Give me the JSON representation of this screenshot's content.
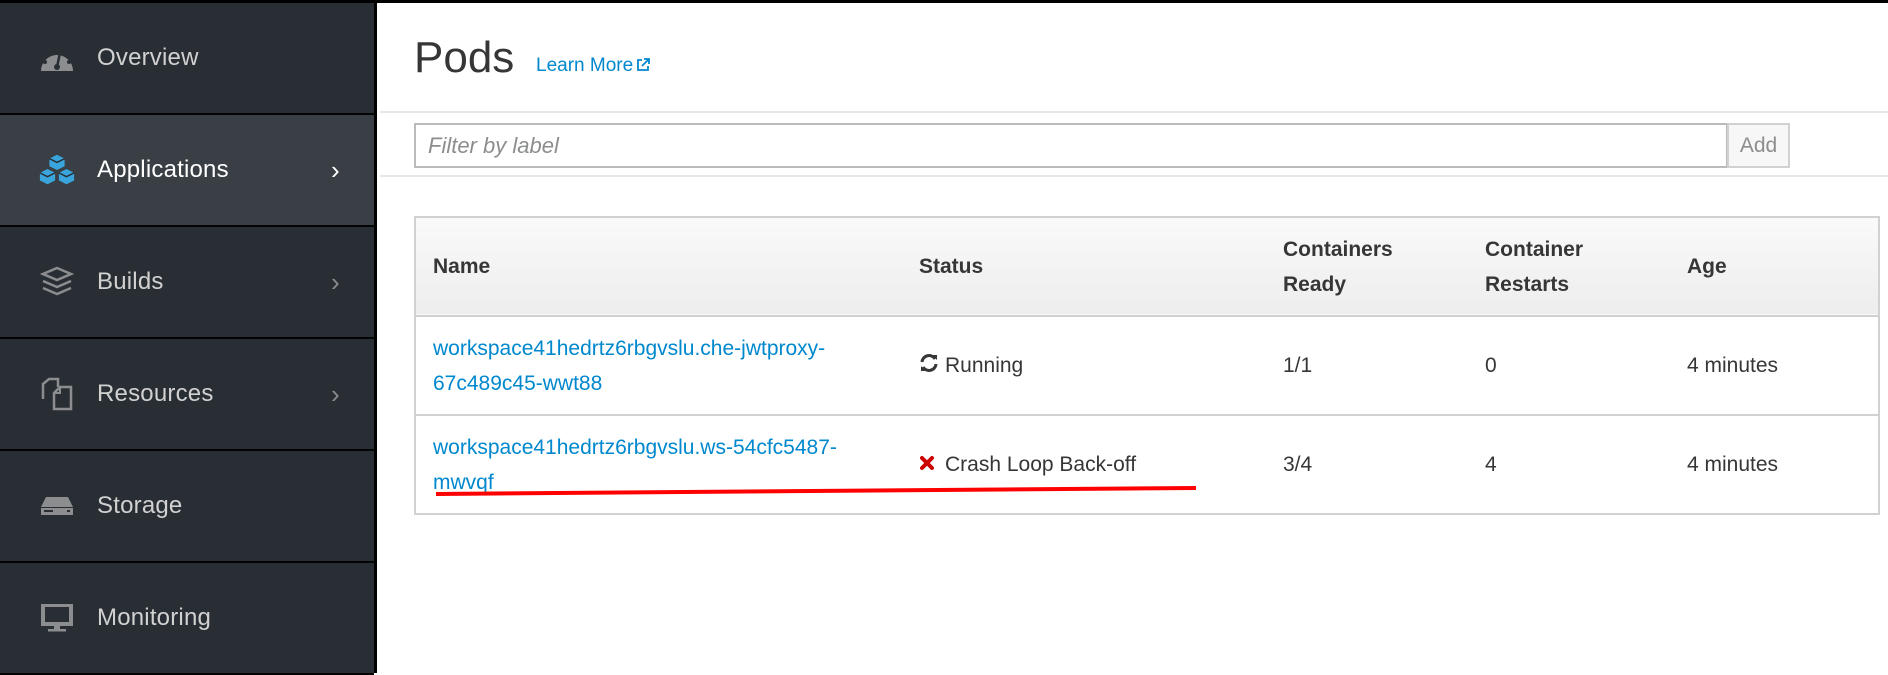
{
  "sidebar": {
    "items": [
      {
        "label": "Overview",
        "icon": "dashboard-gauge-icon",
        "has_chevron": false,
        "active": false
      },
      {
        "label": "Applications",
        "icon": "cubes-icon",
        "has_chevron": true,
        "active": true
      },
      {
        "label": "Builds",
        "icon": "layers-icon",
        "has_chevron": true,
        "active": false
      },
      {
        "label": "Resources",
        "icon": "documents-icon",
        "has_chevron": true,
        "active": false
      },
      {
        "label": "Storage",
        "icon": "storage-drive-icon",
        "has_chevron": false,
        "active": false
      },
      {
        "label": "Monitoring",
        "icon": "monitor-icon",
        "has_chevron": false,
        "active": false
      }
    ],
    "chevron": "›"
  },
  "header": {
    "title": "Pods",
    "learn_more": "Learn More"
  },
  "filter": {
    "placeholder": "Filter by label",
    "value": "",
    "add_label": "Add"
  },
  "table": {
    "headers": {
      "name": "Name",
      "status": "Status",
      "containers_ready_1": "Containers",
      "containers_ready_2": "Ready",
      "container_restarts_1": "Container",
      "container_restarts_2": "Restarts",
      "age": "Age"
    },
    "rows": [
      {
        "name_line1": "workspace41hedrtz6rbgvslu.che-jwtproxy-",
        "name_line2": "67c489c45-wwt88",
        "status": "Running",
        "status_icon": "sync-icon",
        "containers_ready": "1/1",
        "restarts": "0",
        "age": "4 minutes"
      },
      {
        "name_line1": "workspace41hedrtz6rbgvslu.ws-54cfc5487-",
        "name_line2": "mwvqf",
        "status": "Crash Loop Back-off",
        "status_icon": "error-x-icon",
        "containers_ready": "3/4",
        "restarts": "4",
        "age": "4 minutes"
      }
    ]
  },
  "colors": {
    "sidebar_bg": "#292e34",
    "sidebar_active_bg": "#393f44",
    "link": "#0088ce",
    "error": "#cc0000",
    "accent_icon": "#39a5dc",
    "annotation": "#ff0000"
  }
}
